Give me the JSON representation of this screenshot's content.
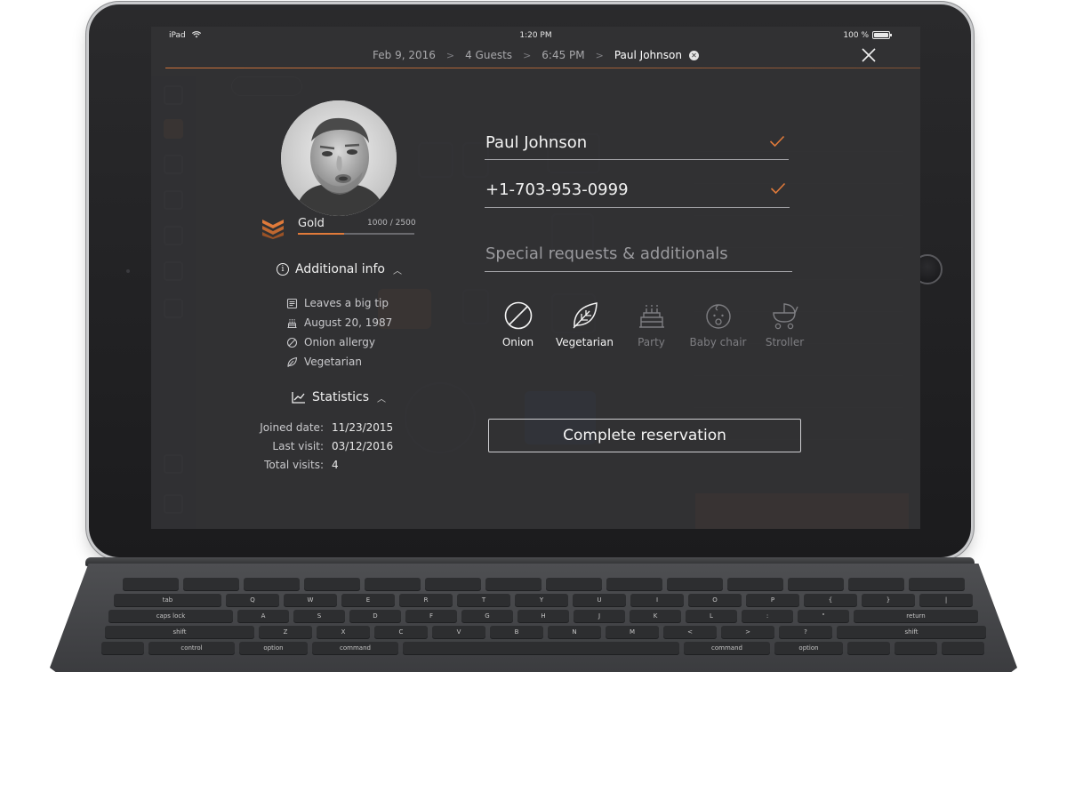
{
  "status_bar": {
    "device": "iPad",
    "wifi_icon": "wifi-icon",
    "time": "1:20 PM",
    "battery_text": "100 %",
    "battery_level": 1.0
  },
  "breadcrumb": {
    "date": "Feb 9, 2016",
    "guests": "4 Guests",
    "time": "6:45 PM",
    "guest_name": "Paul Johnson",
    "separator": ">",
    "remove_icon": "remove-circle-icon",
    "close_icon": "close-icon"
  },
  "profile": {
    "avatar_icon": "guest-avatar",
    "tier": {
      "name": "Gold",
      "points_text": "1000 / 2500",
      "progress": 0.4,
      "icon": "tier-chevrons-icon"
    },
    "additional_info": {
      "title": "Additional info",
      "items": [
        {
          "icon": "note-icon",
          "text": "Leaves a big tip"
        },
        {
          "icon": "cake-icon",
          "text": "August 20, 1987"
        },
        {
          "icon": "no-icon",
          "text": "Onion allergy"
        },
        {
          "icon": "leaf-icon",
          "text": "Vegetarian"
        }
      ]
    },
    "statistics": {
      "title": "Statistics",
      "rows": [
        {
          "label": "Joined date:",
          "value": "11/23/2015"
        },
        {
          "label": "Last visit:",
          "value": "03/12/2016"
        },
        {
          "label": "Total visits:",
          "value": "4"
        }
      ]
    }
  },
  "form": {
    "name_value": "Paul Johnson",
    "phone_value": "+1-703-953-0999",
    "requests_placeholder": "Special requests & additionals",
    "tags": [
      {
        "label": "Onion",
        "icon": "no-icon",
        "active": true
      },
      {
        "label": "Vegetarian",
        "icon": "leaf-icon",
        "active": true
      },
      {
        "label": "Party",
        "icon": "cake-icon",
        "active": false
      },
      {
        "label": "Baby chair",
        "icon": "baby-icon",
        "active": false
      },
      {
        "label": "Stroller",
        "icon": "stroller-icon",
        "active": false
      }
    ],
    "submit_label": "Complete reservation"
  },
  "colors": {
    "accent": "#e07a3a",
    "overlay": "#303032",
    "text_primary": "#f3f3f3",
    "text_muted": "#7e7e82"
  },
  "keyboard": {
    "rows": [
      [
        "",
        "",
        "",
        "",
        "",
        "",
        "",
        "",
        "",
        "",
        "",
        "",
        "",
        ""
      ],
      [
        "tab",
        "Q",
        "W",
        "E",
        "R",
        "T",
        "Y",
        "U",
        "I",
        "O",
        "P",
        "{",
        "}",
        "|"
      ],
      [
        "caps lock",
        "A",
        "S",
        "D",
        "F",
        "G",
        "H",
        "J",
        "K",
        "L",
        ":",
        "\"",
        "return"
      ],
      [
        "shift",
        "Z",
        "X",
        "C",
        "V",
        "B",
        "N",
        "M",
        "<",
        ">",
        "?",
        "shift"
      ],
      [
        "",
        "control",
        "option",
        "command",
        " ",
        "command",
        "option",
        "",
        "",
        ""
      ]
    ]
  }
}
